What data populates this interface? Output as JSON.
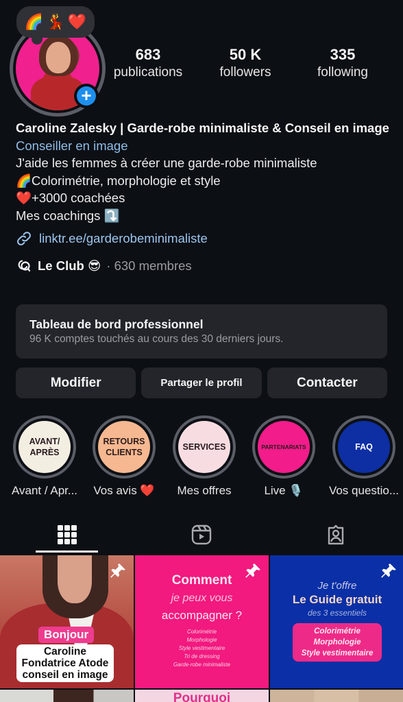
{
  "profile": {
    "note_emojis": [
      "🌈",
      "💃",
      "❤️"
    ],
    "add_story_label": "+",
    "stats": {
      "posts": {
        "value": "683",
        "label": "publications"
      },
      "followers": {
        "value": "50 K",
        "label": "followers"
      },
      "following": {
        "value": "335",
        "label": "following"
      }
    }
  },
  "bio": {
    "name": "Caroline Zalesky | Garde-robe minimaliste & Conseil en image",
    "category": "Conseiller en image",
    "lines": [
      "J'aide les femmes à créer une garde-robe minimaliste",
      "🌈Colorimétrie, morphologie et style",
      "❤️+3000 coachées",
      "Mes coachings ⤵️"
    ],
    "link": "linktr.ee/garderobeminimaliste",
    "channel": {
      "name": "Le Club 😎",
      "members": "· 630 membres"
    }
  },
  "dashboard": {
    "title": "Tableau de bord professionnel",
    "subtitle": "96 K comptes touchés au cours des 30 derniers jours."
  },
  "actions": {
    "edit": "Modifier",
    "share": "Partager le profil",
    "contact": "Contacter"
  },
  "highlights": [
    {
      "cover_text": "AVANT/\nAPRÈS",
      "caption": "Avant / Apr...",
      "color": "#f3eee2"
    },
    {
      "cover_text": "RETOURS\nCLIENTS",
      "caption": "Vos avis ❤️",
      "color": "#f6b890"
    },
    {
      "cover_text": "SERVICES",
      "caption": "Mes offres",
      "color": "#f7dde2"
    },
    {
      "cover_text": "PARTENARIATS",
      "caption": "Live 🎙️",
      "color": "#f21c8a"
    },
    {
      "cover_text": "FAQ",
      "caption": "Vos questio...",
      "color": "#0d2fa3"
    }
  ],
  "tabs": [
    {
      "name": "posts-grid",
      "active": true
    },
    {
      "name": "reels",
      "active": false
    },
    {
      "name": "tagged",
      "active": false
    }
  ],
  "posts": [
    {
      "pinned": true,
      "tag": "Bonjour",
      "caption_lines": [
        "Caroline",
        "Fondatrice Atode",
        "conseil en image"
      ]
    },
    {
      "pinned": true,
      "title": "Comment",
      "subtitle": "je peux vous",
      "title2": "accompagner ?",
      "items": [
        "Colorimétrie",
        "Morphologie",
        "Style vestimentaire",
        "Tri de dressing",
        "Garde-robe minimaliste"
      ]
    },
    {
      "pinned": true,
      "intro": "Je t'offre",
      "title": "Le Guide gratuit",
      "subtitle": "des 3 essentiels",
      "items": [
        "Colorimétrie",
        "Morphologie",
        "Style vestimentaire"
      ]
    },
    {
      "pinned": false
    },
    {
      "pinned": false,
      "title": "Pourquoi"
    },
    {
      "pinned": false
    }
  ],
  "colors": {
    "background": "#0c0f14",
    "card": "#23252b",
    "link": "#9bc6ef",
    "accent_blue": "#1e8fec",
    "muted": "#9a9ca2"
  }
}
